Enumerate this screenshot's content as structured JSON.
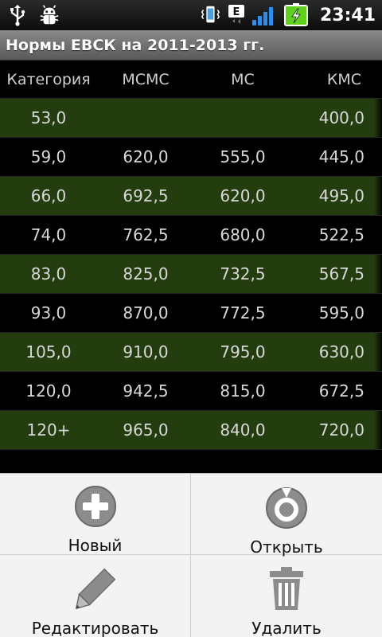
{
  "status_bar": {
    "time": "23:41",
    "network_label": "E",
    "icons": [
      "usb-icon",
      "debug-bug-icon",
      "vibrate-phone-icon",
      "network-e-icon",
      "signal-icon",
      "battery-charging-icon"
    ]
  },
  "title": "Нормы ЕВСК на 2011-2013 гг.",
  "table": {
    "headers": [
      "Категория",
      "МСМС",
      "МС",
      "КМС"
    ],
    "rows": [
      [
        "53,0",
        "",
        "",
        "400,0"
      ],
      [
        "59,0",
        "620,0",
        "555,0",
        "445,0"
      ],
      [
        "66,0",
        "692,5",
        "620,0",
        "495,0"
      ],
      [
        "74,0",
        "762,5",
        "680,0",
        "522,5"
      ],
      [
        "83,0",
        "825,0",
        "732,5",
        "567,5"
      ],
      [
        "93,0",
        "870,0",
        "772,5",
        "595,0"
      ],
      [
        "105,0",
        "910,0",
        "795,0",
        "630,0"
      ],
      [
        "120,0",
        "942,5",
        "815,0",
        "672,5"
      ],
      [
        "120+",
        "965,0",
        "840,0",
        "720,0"
      ]
    ]
  },
  "menu": {
    "items": [
      {
        "label": "Новый",
        "icon": "add-icon"
      },
      {
        "label": "Открыть",
        "icon": "open-icon"
      },
      {
        "label": "Редактировать",
        "icon": "edit-pencil-icon"
      },
      {
        "label": "Удалить",
        "icon": "trash-icon"
      }
    ]
  },
  "colors": {
    "row_green": "#233d0e",
    "row_black": "#000000",
    "title_bar": "#6f6f6f",
    "menu_bg": "#f3f3f3",
    "signal_blue": "#2a8ef0",
    "battery_green": "#5fd21b"
  }
}
